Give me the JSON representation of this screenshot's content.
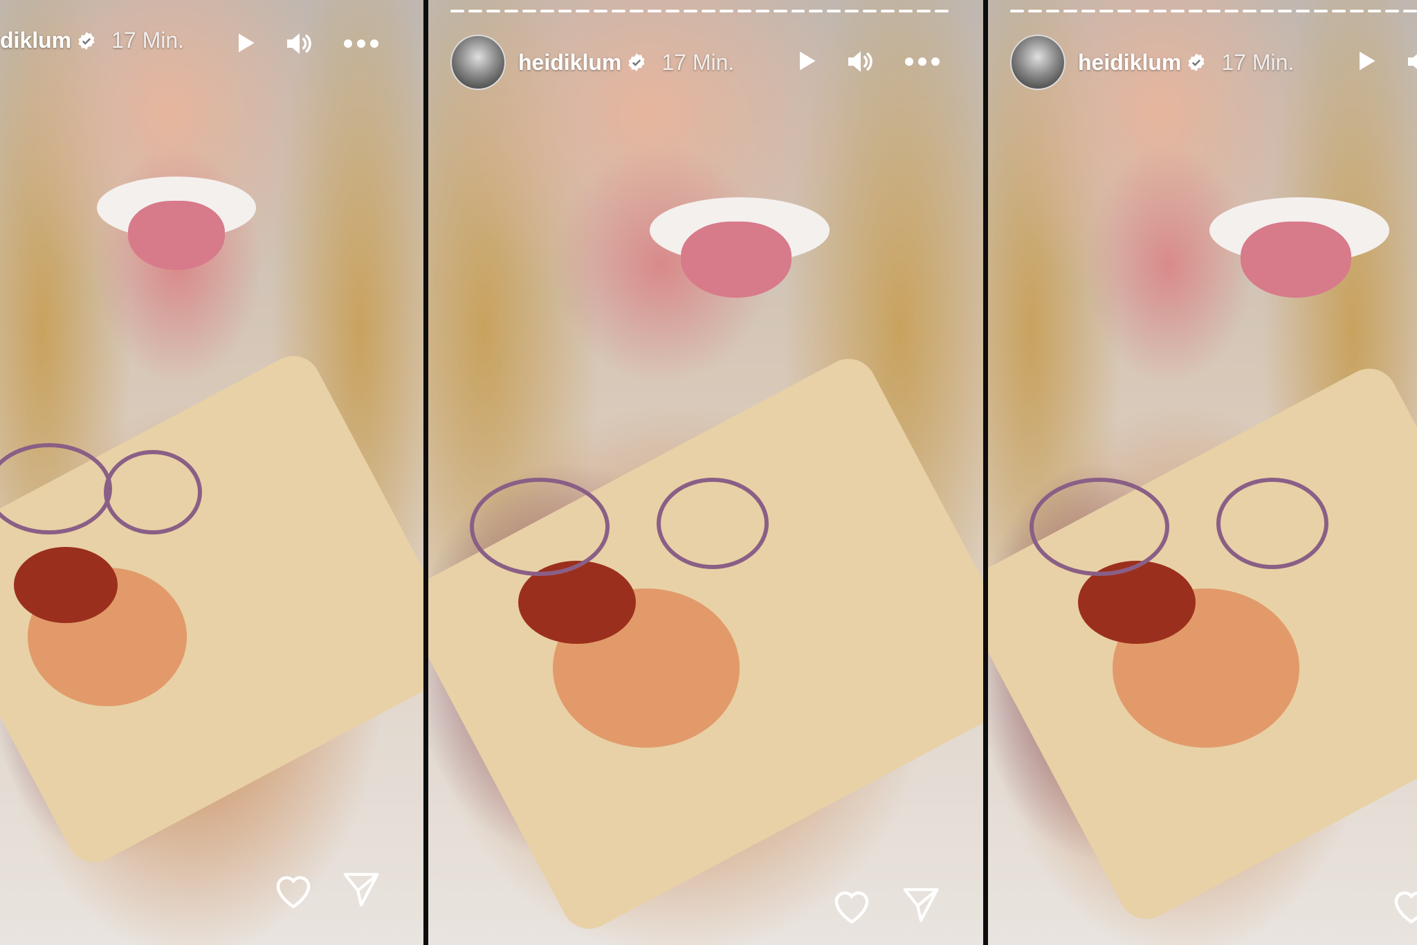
{
  "stories": [
    {
      "username": "heidiklum",
      "visible_username": "diklum",
      "time": "17 Min."
    },
    {
      "username": "heidiklum",
      "time": "17 Min."
    },
    {
      "username": "heidiklum",
      "time": "17 Min."
    }
  ],
  "icons": {
    "verified": "verified-badge-icon",
    "play": "play-icon",
    "sound": "volume-icon",
    "more": "more-options-icon",
    "like": "heart-icon",
    "share": "send-icon"
  },
  "colors": {
    "text": "#ffffff",
    "divider": "#0d0d0d"
  }
}
